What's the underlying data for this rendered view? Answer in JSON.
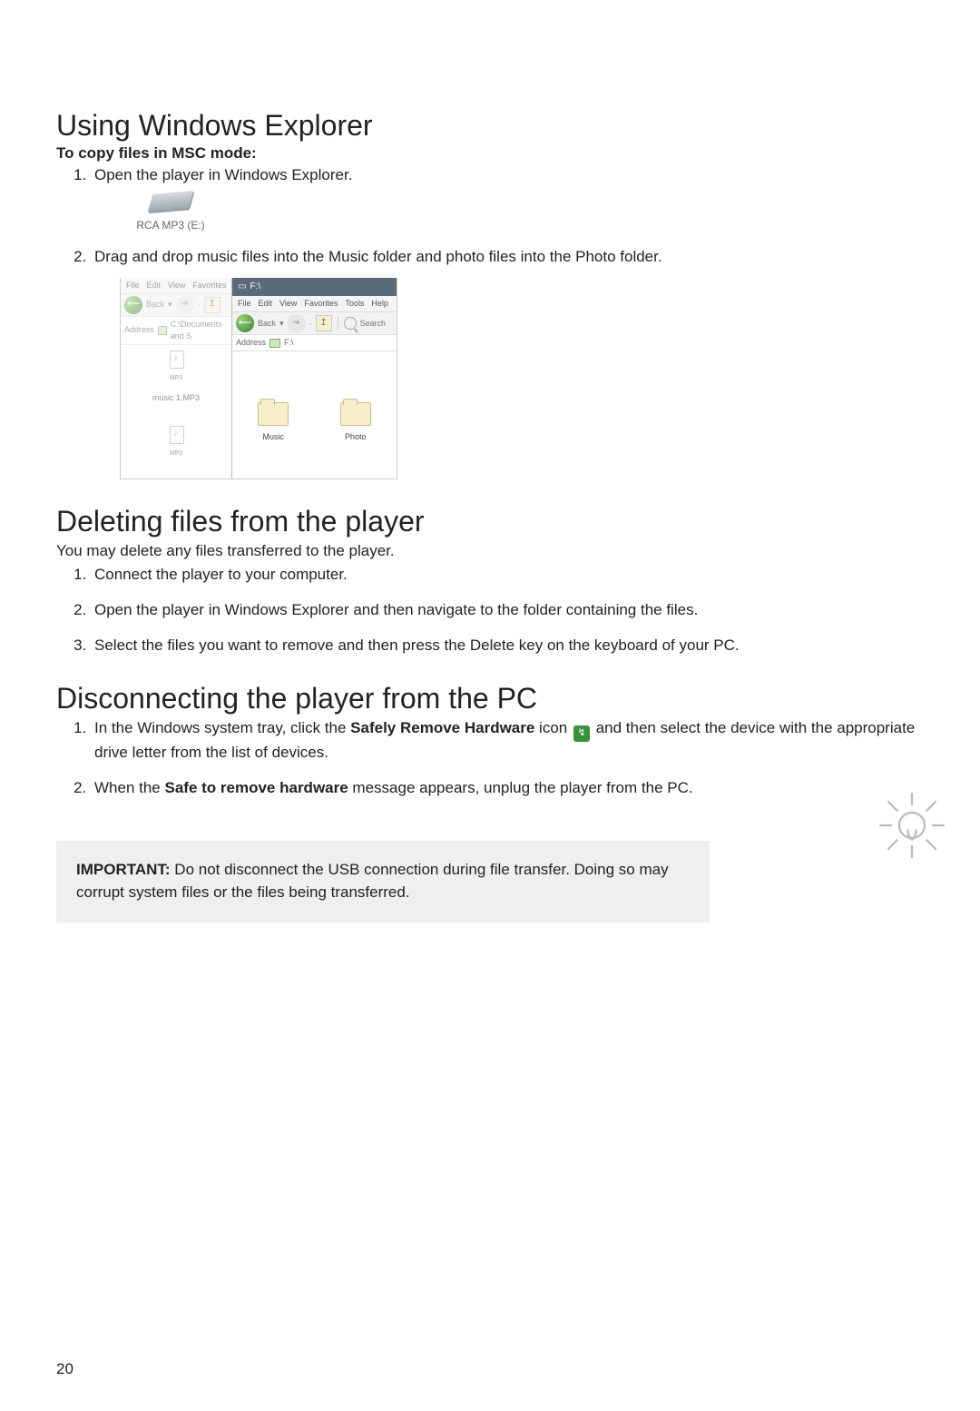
{
  "section1": {
    "heading": "Using Windows Explorer",
    "sub": "To copy files in MSC mode:",
    "step1": "Open the player in Windows Explorer.",
    "drive_label": "RCA MP3 (E:)",
    "step2": "Drag and drop music files into the Music folder and photo files into the Photo folder."
  },
  "explorer": {
    "left": {
      "menu": [
        "File",
        "Edit",
        "View",
        "Favorites"
      ],
      "back": "Back",
      "address_label": "Address",
      "address_value": "C:\\Documents and S",
      "file_label": "music 1.MP3",
      "mp3_tag": "MP3"
    },
    "right": {
      "title": "F:\\",
      "menu": [
        "File",
        "Edit",
        "View",
        "Favorites",
        "Tools",
        "Help"
      ],
      "back": "Back",
      "search": "Search",
      "address_label": "Address",
      "address_value": "F:\\",
      "folders": [
        "Music",
        "Photo"
      ]
    }
  },
  "section2": {
    "heading": "Deleting files from the player",
    "intro": "You may delete any files transferred to the player.",
    "step1": "Connect the player to your computer.",
    "step2": "Open the player in Windows Explorer and then navigate to the folder containing the files.",
    "step3": "Select the files you want to remove and then press the Delete key on the keyboard of your PC."
  },
  "section3": {
    "heading": "Disconnecting the player from the PC",
    "step1_a": "In the Windows system tray, click the ",
    "step1_bold": "Safely Remove Hardware",
    "step1_b": " icon ",
    "step1_c": " and then select the device with the appropriate drive letter from the list of devices.",
    "step2_a": "When the ",
    "step2_bold": "Safe to remove hardware",
    "step2_b": " message appears, unplug the player from the PC."
  },
  "important": {
    "label": "IMPORTANT:",
    "text": " Do not disconnect the USB connection during file transfer. Doing so may corrupt system files or the files being transferred."
  },
  "page_number": "20"
}
